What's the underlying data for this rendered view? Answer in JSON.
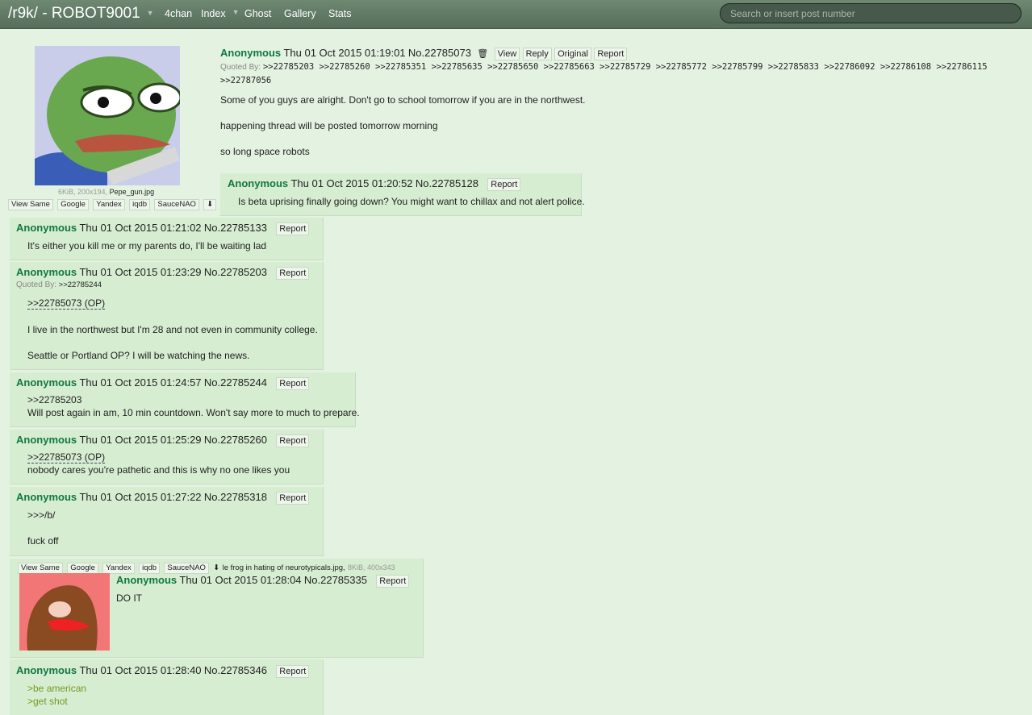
{
  "topbar": {
    "board": "/r9k/ - ROBOT9001",
    "nav": [
      "4chan",
      "Index",
      "Ghost",
      "Gallery",
      "Stats"
    ],
    "search_placeholder": "Search or insert post number"
  },
  "op": {
    "name": "Anonymous",
    "date": "Thu 01 Oct 2015 01:19:01",
    "number": "No.22785073",
    "buttons": [
      "View",
      "Reply",
      "Original",
      "Report"
    ],
    "quoted_by_label": "Quoted By:",
    "quoted_by_line1": ">>22785203 >>22785260 >>22785351 >>22785635 >>22785650 >>22785663 >>22785729 >>22785772 >>22785799 >>22785833 >>22786092 >>22786108 >>22786115",
    "quoted_by_line2": ">>22787056",
    "lines": [
      "Some of you guys are alright. Don't go to school tomorrow if you are in the northwest.",
      "happening thread will be posted tomorrow morning",
      "so long space robots"
    ],
    "file_meta": "6KiB, 200x194,",
    "file_name": "Pepe_gun.jpg",
    "image_buttons": [
      "View Same",
      "Google",
      "Yandex",
      "iqdb",
      "SauceNAO"
    ]
  },
  "posts": [
    {
      "name": "Anonymous",
      "date": "Thu 01 Oct 2015 01:20:52",
      "number": "No.22785128",
      "report": "Report",
      "line1": "Is beta uprising finally going down? You might want to chillax and not alert police."
    },
    {
      "name": "Anonymous",
      "date": "Thu 01 Oct 2015 01:21:02",
      "number": "No.22785133",
      "report": "Report",
      "line1": "It's either you kill me or my parents do, I'll be waiting lad"
    },
    {
      "name": "Anonymous",
      "date": "Thu 01 Oct 2015 01:23:29",
      "number": "No.22785203",
      "report": "Report",
      "quoted_by": "Quoted By:",
      "quoted_link": ">>22785244",
      "quote": ">>22785073 (OP)",
      "line1": "I live in the northwest but I'm 28 and not even in community college.",
      "line2": "Seattle or Portland OP? I will be watching the news."
    },
    {
      "name": "Anonymous",
      "date": "Thu 01 Oct 2015 01:24:57",
      "number": "No.22785244",
      "report": "Report",
      "quote": ">>22785203",
      "line1": "Will post again in am, 10 min countdown. Won't say more to much to prepare."
    },
    {
      "name": "Anonymous",
      "date": "Thu 01 Oct 2015 01:25:29",
      "number": "No.22785260",
      "report": "Report",
      "quote": ">>22785073 (OP)",
      "line1": "nobody cares you're pathetic and this is why no one likes you"
    },
    {
      "name": "Anonymous",
      "date": "Thu 01 Oct 2015 01:27:22",
      "number": "No.22785318",
      "report": "Report",
      "line1": ">>>/b/",
      "line2": "fuck off"
    },
    {
      "name": "Anonymous",
      "date": "Thu 01 Oct 2015 01:28:04",
      "number": "No.22785335",
      "report": "Report",
      "line1": "DO IT",
      "image_buttons": [
        "View Same",
        "Google",
        "Yandex",
        "iqdb",
        "SauceNAO"
      ],
      "file_name": "le frog in hating of neurotypicals.jpg,",
      "file_meta": "8KiB, 400x343"
    },
    {
      "name": "Anonymous",
      "date": "Thu 01 Oct 2015 01:28:40",
      "number": "No.22785346",
      "report": "Report",
      "line1": ">be american",
      "line2": ">get shot"
    }
  ],
  "colors": {
    "background": "#e4f2e1",
    "reply": "#d6edd1",
    "name": "#117743",
    "greentext": "#789922",
    "topbar": "#5f7864"
  }
}
